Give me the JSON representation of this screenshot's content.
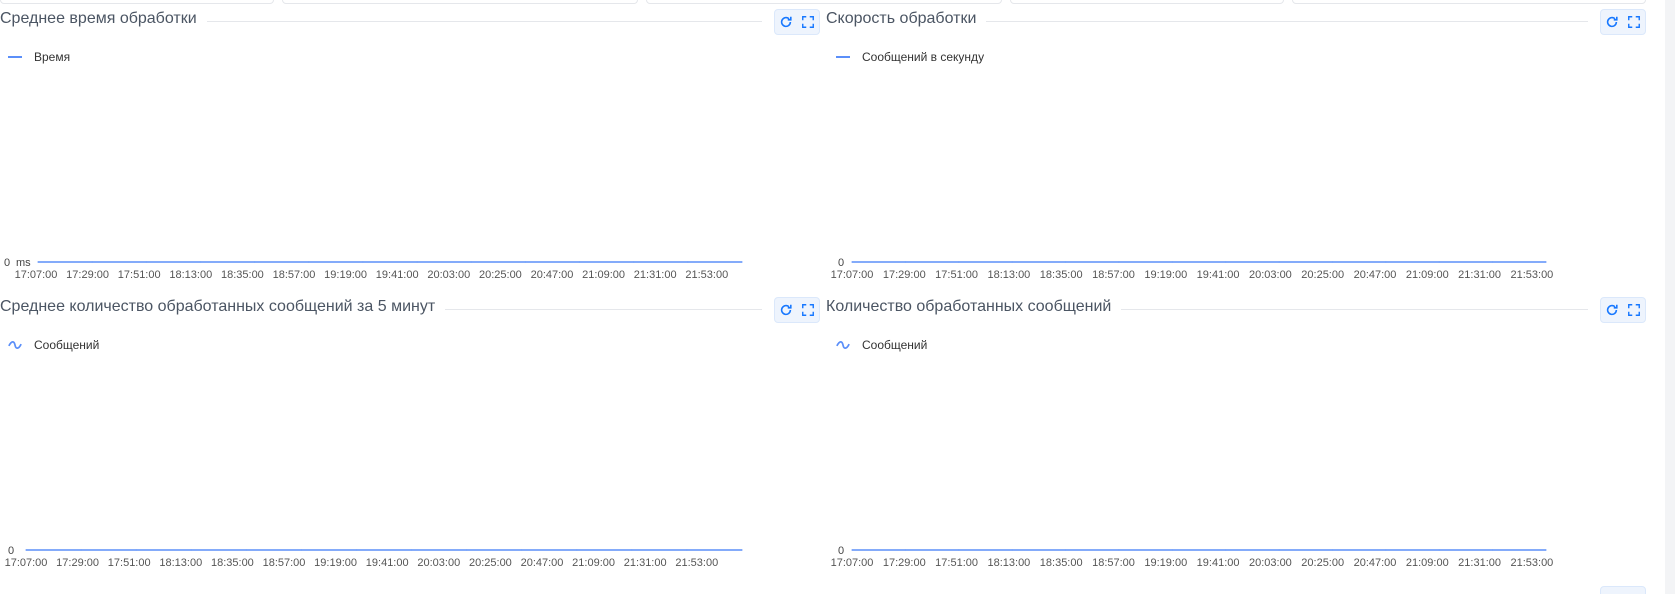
{
  "panels": [
    {
      "title": "Среднее время обработки",
      "legend": "Время",
      "legend_icon": "line-legend-icon",
      "y_zero_label": "0",
      "y_unit": "ms",
      "refresh_icon": "refresh-icon",
      "fullscreen_icon": "fullscreen-icon"
    },
    {
      "title": "Скорость обработки",
      "legend": "Сообщений в секунду",
      "legend_icon": "line-legend-icon",
      "y_zero_label": "0",
      "y_unit": "",
      "refresh_icon": "refresh-icon",
      "fullscreen_icon": "fullscreen-icon"
    },
    {
      "title": "Среднее количество обработанных сообщений за 5 минут",
      "legend": "Сообщений",
      "legend_icon": "wave-legend-icon",
      "y_zero_label": "0",
      "y_unit": "",
      "refresh_icon": "refresh-icon",
      "fullscreen_icon": "fullscreen-icon"
    },
    {
      "title": "Количество обработанных сообщений",
      "legend": "Сообщений",
      "legend_icon": "wave-legend-icon",
      "y_zero_label": "0",
      "y_unit": "",
      "refresh_icon": "refresh-icon",
      "fullscreen_icon": "fullscreen-icon"
    }
  ],
  "colors": {
    "series": "#5b8ff9",
    "accent": "#1677ff",
    "grid": "#e5e7eb",
    "text": "#4b5563"
  },
  "chart_data": [
    {
      "type": "line",
      "title": "Среднее время обработки",
      "x": [
        "17:07:00",
        "17:29:00",
        "17:51:00",
        "18:13:00",
        "18:35:00",
        "18:57:00",
        "19:19:00",
        "19:41:00",
        "20:03:00",
        "20:25:00",
        "20:47:00",
        "21:09:00",
        "21:31:00",
        "21:53:00"
      ],
      "series": [
        {
          "name": "Время",
          "values": [
            0,
            0,
            0,
            0,
            0,
            0,
            0,
            0,
            0,
            0,
            0,
            0,
            0,
            0
          ]
        }
      ],
      "ylabel": "ms",
      "ylim": [
        0,
        0
      ]
    },
    {
      "type": "line",
      "title": "Скорость обработки",
      "x": [
        "17:07:00",
        "17:29:00",
        "17:51:00",
        "18:13:00",
        "18:35:00",
        "18:57:00",
        "19:19:00",
        "19:41:00",
        "20:03:00",
        "20:25:00",
        "20:47:00",
        "21:09:00",
        "21:31:00",
        "21:53:00"
      ],
      "series": [
        {
          "name": "Сообщений в секунду",
          "values": [
            0,
            0,
            0,
            0,
            0,
            0,
            0,
            0,
            0,
            0,
            0,
            0,
            0,
            0
          ]
        }
      ],
      "ylim": [
        0,
        0
      ]
    },
    {
      "type": "area",
      "title": "Среднее количество обработанных сообщений за 5 минут",
      "x": [
        "17:07:00",
        "17:29:00",
        "17:51:00",
        "18:13:00",
        "18:35:00",
        "18:57:00",
        "19:19:00",
        "19:41:00",
        "20:03:00",
        "20:25:00",
        "20:47:00",
        "21:09:00",
        "21:31:00",
        "21:53:00"
      ],
      "series": [
        {
          "name": "Сообщений",
          "values": [
            0,
            0,
            0,
            0,
            0,
            0,
            0,
            0,
            0,
            0,
            0,
            0,
            0,
            0
          ]
        }
      ],
      "ylim": [
        0,
        0
      ]
    },
    {
      "type": "area",
      "title": "Количество обработанных сообщений",
      "x": [
        "17:07:00",
        "17:29:00",
        "17:51:00",
        "18:13:00",
        "18:35:00",
        "18:57:00",
        "19:19:00",
        "19:41:00",
        "20:03:00",
        "20:25:00",
        "20:47:00",
        "21:09:00",
        "21:31:00",
        "21:53:00"
      ],
      "series": [
        {
          "name": "Сообщений",
          "values": [
            0,
            0,
            0,
            0,
            0,
            0,
            0,
            0,
            0,
            0,
            0,
            0,
            0,
            0
          ]
        }
      ],
      "ylim": [
        0,
        0
      ]
    }
  ]
}
